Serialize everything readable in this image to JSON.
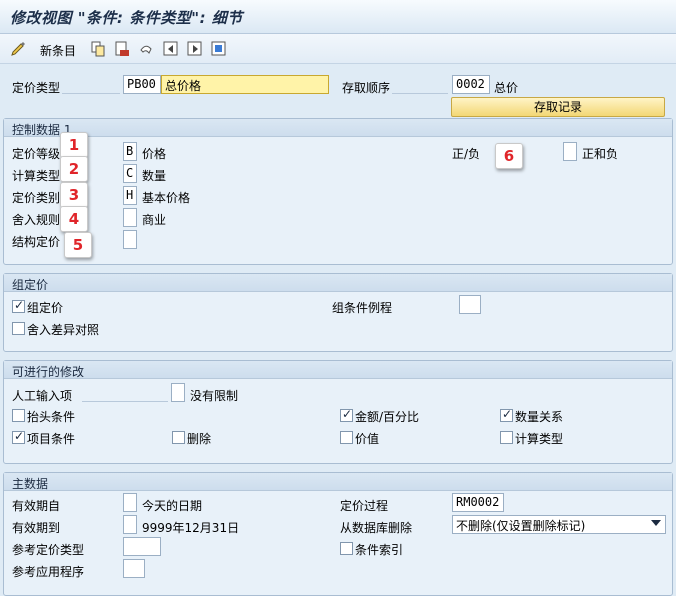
{
  "window": {
    "title": "修改视图 \"条件: 条件类型\": 细节"
  },
  "toolbar": {
    "new_entries_label": "新条目"
  },
  "header": {
    "pricing_type_label": "定价类型",
    "pricing_type_code": "PB00",
    "pricing_type_desc": "总价格",
    "access_seq_label": "存取顺序",
    "access_seq_code": "0002",
    "access_seq_desc": "总价",
    "access_records_button": "存取记录"
  },
  "control": {
    "title": "控制数据 1",
    "rows": [
      {
        "label": "定价等级",
        "value": "B",
        "desc": "价格",
        "badge": "1"
      },
      {
        "label": "计算类型",
        "value": "C",
        "desc": "数量",
        "badge": "2"
      },
      {
        "label": "定价类别",
        "value": "H",
        "desc": "基本价格",
        "badge": "3"
      },
      {
        "label": "舍入规则",
        "value": "",
        "desc": "商业",
        "badge": "4"
      },
      {
        "label": "结构定价",
        "value": "",
        "desc": "",
        "badge": "5"
      }
    ],
    "plus_minus_label": "正/负",
    "plus_minus_badge": "6",
    "plus_minus_desc": "正和负"
  },
  "group_pricing": {
    "title": "组定价",
    "group_cond_label": "组定价",
    "rounding_diff_label": "舍入差异对照",
    "group_routine_label": "组条件例程"
  },
  "changes": {
    "title": "可进行的修改",
    "manual_entry_label": "人工输入项",
    "manual_entry_desc": "没有限制",
    "header_cond_label": "抬头条件",
    "item_cond_label": "项目条件",
    "delete_label": "删除",
    "amount_pct_label": "金额/百分比",
    "value_label": "价值",
    "qty_relation_label": "数量关系",
    "calc_type_label": "计算类型"
  },
  "master": {
    "title": "主数据",
    "valid_from_label": "有效期自",
    "valid_from_desc": "今天的日期",
    "valid_to_label": "有效期到",
    "valid_to_desc": "9999年12月31日",
    "ref_pricing_type_label": "参考定价类型",
    "ref_application_label": "参考应用程序",
    "pricing_proc_label": "定价过程",
    "pricing_proc_value": "RM0002",
    "delete_from_db_label": "从数据库删除",
    "delete_from_db_value": "不删除(仅设置删除标记)",
    "cond_index_label": "条件索引"
  },
  "colors": {
    "background": "#dfebf5",
    "badge_text": "#e0252a",
    "button_bg": "#f3d775"
  },
  "icons": [
    "pen-icon",
    "copy-icon",
    "delete-icon",
    "undo-icon",
    "prev-icon",
    "next-icon",
    "select-icon"
  ]
}
